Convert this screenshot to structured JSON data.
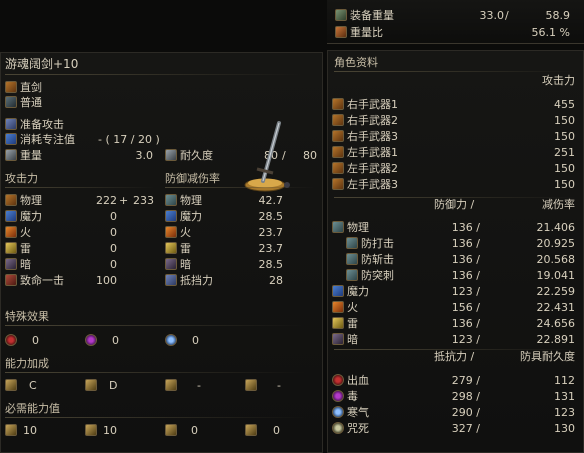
{
  "top": {
    "equip_load": {
      "label": "装备重量",
      "current": "33.0",
      "max": "58.9",
      "sep": "/"
    },
    "load_ratio": {
      "label": "重量比",
      "value": "56.1 %"
    }
  },
  "weapon": {
    "name": "游魂阔剑+10",
    "type": "直剑",
    "attack_type": "普通",
    "skill": "准备攻击",
    "fp_cost": {
      "label": "消耗专注值",
      "value": "- ( 17 / 20 )"
    },
    "weight": {
      "label": "重量",
      "value": "3.0"
    },
    "durability": {
      "label": "耐久度",
      "current": "80",
      "max": "80",
      "sep": "/"
    }
  },
  "attack": {
    "title": "攻击力",
    "rows": [
      {
        "label": "物理",
        "value": "222",
        "plus": "+",
        "bonus": "233"
      },
      {
        "label": "魔力",
        "value": "0"
      },
      {
        "label": "火",
        "value": "0"
      },
      {
        "label": "雷",
        "value": "0"
      },
      {
        "label": "暗",
        "value": "0"
      },
      {
        "label": "致命一击",
        "value": "100"
      }
    ]
  },
  "guard": {
    "title": "防御减伤率",
    "rows": [
      {
        "label": "物理",
        "value": "42.7"
      },
      {
        "label": "魔力",
        "value": "28.5"
      },
      {
        "label": "火",
        "value": "23.7"
      },
      {
        "label": "雷",
        "value": "23.7"
      },
      {
        "label": "暗",
        "value": "28.5"
      },
      {
        "label": "抵挡力",
        "value": "28"
      }
    ]
  },
  "effects": {
    "title": "特殊效果",
    "values": [
      "0",
      "0",
      "0"
    ]
  },
  "scaling": {
    "title": "能力加成",
    "values": [
      "C",
      "D",
      "-",
      "-"
    ]
  },
  "requirements": {
    "title": "必需能力值",
    "values": [
      "10",
      "10",
      "0",
      "0"
    ]
  },
  "character": {
    "title": "角色资料",
    "attack_header": "攻击力",
    "weapons": [
      {
        "label": "右手武器1",
        "value": "455"
      },
      {
        "label": "右手武器2",
        "value": "150"
      },
      {
        "label": "右手武器3",
        "value": "150"
      },
      {
        "label": "左手武器1",
        "value": "251"
      },
      {
        "label": "左手武器2",
        "value": "150"
      },
      {
        "label": "左手武器3",
        "value": "150"
      }
    ],
    "def_header": "防御力 /",
    "abs_header": "减伤率",
    "defense": [
      {
        "label": "物理",
        "def": "136 /",
        "abs": "21.406",
        "sub": false
      },
      {
        "label": "防打击",
        "def": "136 /",
        "abs": "20.925",
        "sub": true
      },
      {
        "label": "防斩击",
        "def": "136 /",
        "abs": "20.568",
        "sub": true
      },
      {
        "label": "防突刺",
        "def": "136 /",
        "abs": "19.041",
        "sub": true
      },
      {
        "label": "魔力",
        "def": "123 /",
        "abs": "22.259",
        "sub": false
      },
      {
        "label": "火",
        "def": "156 /",
        "abs": "22.431",
        "sub": false
      },
      {
        "label": "雷",
        "def": "136 /",
        "abs": "24.656",
        "sub": false
      },
      {
        "label": "暗",
        "def": "123 /",
        "abs": "22.891",
        "sub": false
      }
    ],
    "res_header": "抵抗力 /",
    "armor_header": "防具耐久度",
    "resist": [
      {
        "label": "出血",
        "res": "279 /",
        "dur": "112"
      },
      {
        "label": "毒",
        "res": "298 /",
        "dur": "131"
      },
      {
        "label": "寒气",
        "res": "290 /",
        "dur": "123"
      },
      {
        "label": "咒死",
        "res": "327 /",
        "dur": "130"
      }
    ]
  }
}
